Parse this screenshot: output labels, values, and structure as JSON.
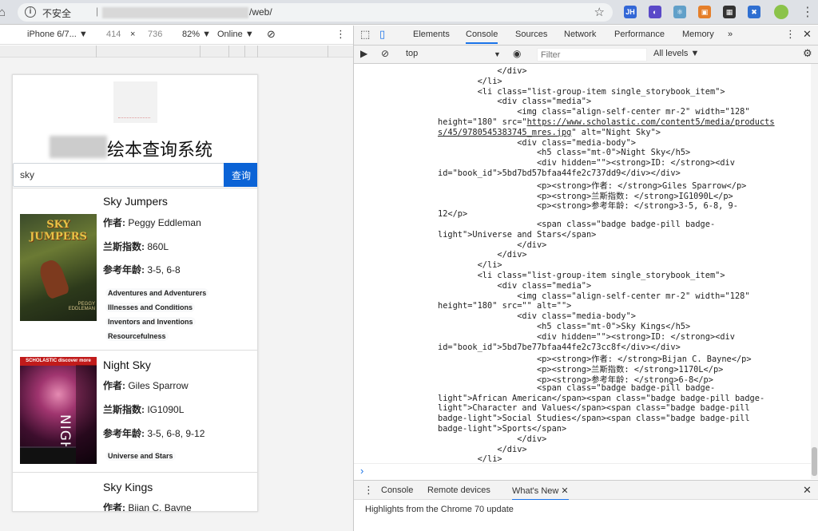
{
  "address_bar": {
    "security_label": "不安全",
    "separator": "|",
    "url_suffix": "/web/",
    "icons": [
      "home-icon",
      "info-icon",
      "star-icon",
      "extension-icons",
      "avatar",
      "menu-icon"
    ]
  },
  "extensions": [
    {
      "label": "JH",
      "color": "#3367d6"
    },
    {
      "label": "◐",
      "color": "#5a49c8"
    },
    {
      "label": "⚛",
      "color": "#61a0c9"
    },
    {
      "label": "▣",
      "color": "#e57f2a"
    },
    {
      "label": "▦",
      "color": "#333333"
    },
    {
      "label": "✖",
      "color": "#2f6fd1"
    }
  ],
  "device_toolbar": {
    "device": "iPhone 6/7...",
    "width": "414",
    "times": "×",
    "height": "736",
    "zoom": "82%",
    "network": "Online"
  },
  "app": {
    "title": "绘本查询系统",
    "search_value": "sky",
    "search_button": "查询",
    "author_label": "作者:",
    "lexile_label": "兰斯指数:",
    "age_label": "参考年龄:"
  },
  "books": [
    {
      "title": "Sky Jumpers",
      "author": "Peggy Eddleman",
      "lexile": "860L",
      "age": "3-5, 6-8",
      "badges": [
        "Adventures and Adventurers",
        "Illnesses and Conditions",
        "Inventors and Inventions",
        "Resourcefulness"
      ],
      "cover_text": "SKY JUMPERS",
      "cover_author": "PEGGY EDDLEMAN"
    },
    {
      "title": "Night Sky",
      "author": "Giles Sparrow",
      "lexile": "IG1090L",
      "age": "3-5, 6-8, 9-12",
      "badges": [
        "Universe and Stars"
      ],
      "cover_text": "NIGHT SKY",
      "cover_header": "SCHOLASTIC discover more"
    },
    {
      "title": "Sky Kings",
      "author": "Bijan C. Bayne",
      "lexile": "",
      "age": "",
      "badges": []
    }
  ],
  "devtools": {
    "tabs": [
      "Elements",
      "Console",
      "Sources",
      "Network",
      "Performance",
      "Memory",
      "»"
    ],
    "active_tab": "Console",
    "context": "top",
    "filter_placeholder": "Filter",
    "levels": "All levels ▼",
    "drawer_tabs": [
      "Console",
      "Remote devices",
      "What's New"
    ],
    "drawer_active": "What's New",
    "drawer_message": "Highlights from the Chrome 70 update",
    "prompt": "›"
  },
  "console_lines": [
    "            </div>",
    "        </li>",
    "        <li class=\"list-group-item single_storybook_item\">",
    "            <div class=\"media\">",
    "                <img class=\"align-self-center mr-2\" width=\"128\"",
    "height=\"180\" src=\"https://www.scholastic.com/content5/media/products",
    "s/45/9780545383745_mres.jpg\" alt=\"Night Sky\">",
    "                <div class=\"media-body\">",
    "                    <h5 class=\"mt-0\">Night Sky</h5>",
    "                    <div hidden=\"\"><strong>ID: </strong><div",
    "id=\"book_id\">5bd7bd57bfaa44fe2c737dd9</div></div>",
    "                    <p><strong>作者: </strong>Giles Sparrow</p>",
    "                    <p><strong>兰斯指数: </strong>IG1090L</p>",
    "                    <p><strong>参考年龄: </strong>3-5, 6-8, 9-",
    "12</p>",
    "                    <span class=\"badge badge-pill badge-",
    "light\">Universe and Stars</span>",
    "                </div>",
    "            </div>",
    "        </li>",
    "        <li class=\"list-group-item single_storybook_item\">",
    "            <div class=\"media\">",
    "                <img class=\"align-self-center mr-2\" width=\"128\"",
    "height=\"180\" src=\"\" alt=\"\">",
    "                <div class=\"media-body\">",
    "                    <h5 class=\"mt-0\">Sky Kings</h5>",
    "                    <div hidden=\"\"><strong>ID: </strong><div",
    "id=\"book_id\">5bd7be77bfaa44fe2c73cc8f</div></div>",
    "                    <p><strong>作者: </strong>Bijan C. Bayne</p>",
    "                    <p><strong>兰斯指数: </strong>1170L</p>",
    "                    <p><strong>参考年龄: </strong>6-8</p>",
    "                    <span class=\"badge badge-pill badge-",
    "light\">African American</span><span class=\"badge badge-pill badge-",
    "light\">Character and Values</span><span class=\"badge badge-pill",
    "badge-light\">Social Studies</span><span class=\"badge badge-pill",
    "badge-light\">Sports</span>",
    "                </div>",
    "            </div>",
    "        </li>"
  ],
  "colors": {
    "search_button": "#0b63d6",
    "devtools_accent": "#1a73e8"
  }
}
